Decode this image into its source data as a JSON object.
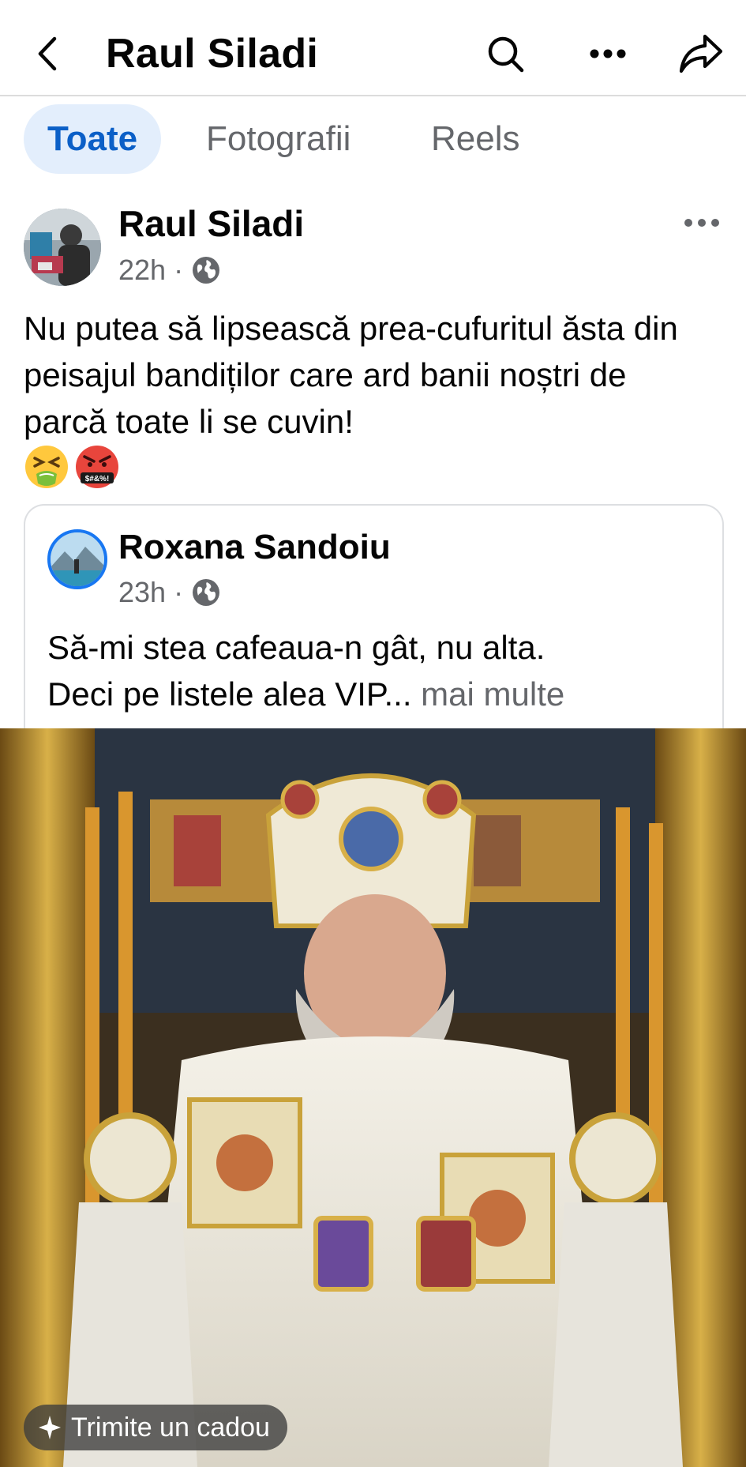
{
  "header": {
    "title": "Raul Siladi",
    "icons": [
      "back-arrow-icon",
      "search-icon",
      "more-options-icon",
      "share-icon"
    ]
  },
  "tabs": [
    {
      "label": "Toate",
      "active": true
    },
    {
      "label": "Fotografii",
      "active": false
    },
    {
      "label": "Reels",
      "active": false
    }
  ],
  "post": {
    "author": "Raul Siladi",
    "time": "22h",
    "separator": "·",
    "privacy_icon": "globe-icon",
    "text": "Nu putea să lipsească prea-cufuritul ăsta din peisajul bandiților care ard banii noștri de parcă toate li se cuvin!",
    "emojis": [
      "tired-face-emoji",
      "face-with-symbols-on-mouth-emoji"
    ]
  },
  "shared_post": {
    "author": "Roxana Sandoiu",
    "time": "23h",
    "separator": "·",
    "privacy_icon": "globe-icon",
    "text_line1": "Să-mi stea cafeaua-n gât, nu alta.",
    "text_line2": "Deci pe listele alea VIP...",
    "more_label": "mai multe"
  },
  "gift": {
    "label": "Trimite un cadou",
    "icon": "gift-sparkle-icon"
  },
  "colors": {
    "active_tab_bg": "#e3eefc",
    "active_tab_text": "#0b5fc7",
    "secondary_text": "#65676b",
    "primary_text": "#050505"
  }
}
